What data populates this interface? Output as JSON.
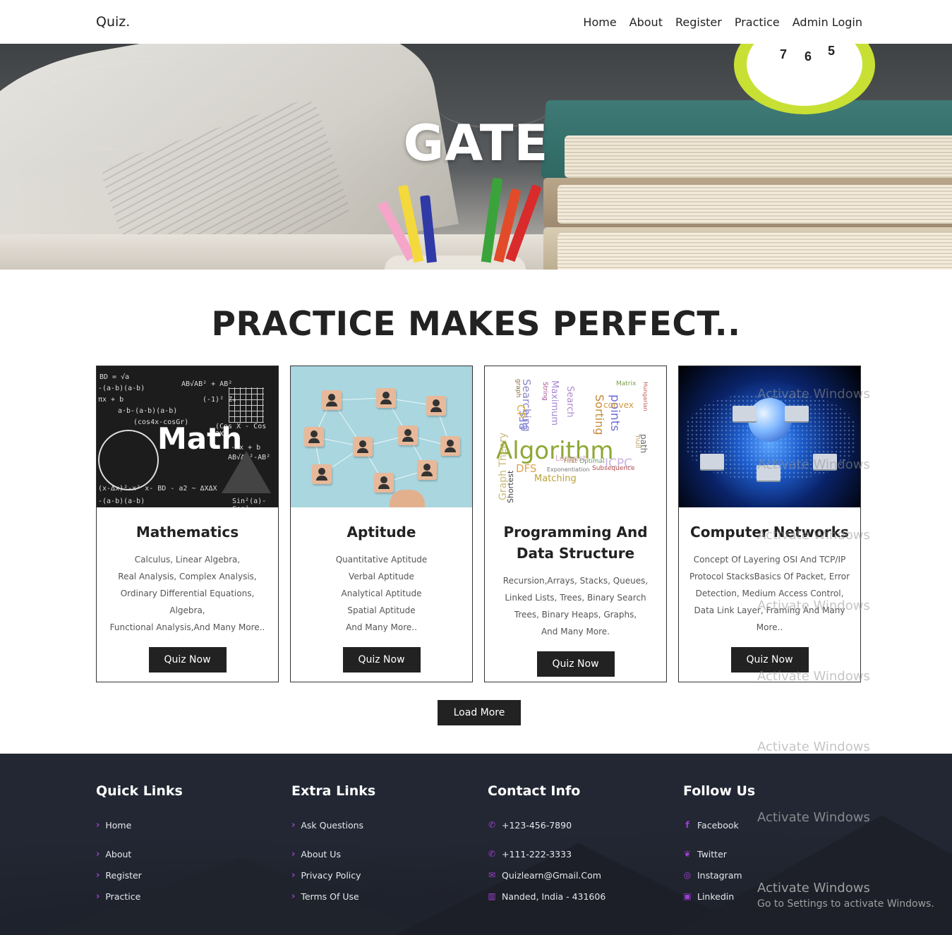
{
  "nav": {
    "brand": "Quiz.",
    "links": [
      "Home",
      "About",
      "Register",
      "Practice",
      "Admin Login"
    ]
  },
  "hero": {
    "title": "GATE"
  },
  "practice": {
    "title": "PRACTICE MAKES PERFECT..",
    "cards": [
      {
        "title": "Mathematics",
        "image": "math-chalkboard-image",
        "desc": [
          "Calculus, Linear Algebra,",
          "Real Analysis, Complex Analysis,",
          "Ordinary Differential Equations,",
          "Algebra,",
          "Functional Analysis,And Many More.."
        ],
        "button": "Quiz Now"
      },
      {
        "title": "Aptitude",
        "image": "network-blocks-image",
        "desc": [
          "Quantitative Aptitude",
          "Verbal Aptitude",
          "Analytical Aptitude",
          "Spatial Aptitude",
          "And Many More.."
        ],
        "button": "Quiz Now"
      },
      {
        "title": "Programming And Data Structure",
        "title_lines": [
          "Programming And",
          "Data Structure"
        ],
        "image": "algorithm-word-cloud-image",
        "desc": [
          "Recursion,Arrays, Stacks, Queues,",
          "Linked Lists, Trees, Binary Search",
          "Trees, Binary Heaps, Graphs,",
          "And Many More."
        ],
        "button": "Quiz Now"
      },
      {
        "title": "Computer Networks",
        "image": "globe-network-image",
        "desc": [
          "Concept Of Layering OSI And TCP/IP",
          "Protocol StacksBasics Of Packet, Error",
          "Detection, Medium Access Control,",
          "Data Link Layer, Framing And Many",
          "More.."
        ],
        "button": "Quiz Now"
      }
    ],
    "load_more": "Load More"
  },
  "images": {
    "math": {
      "word": "Math",
      "formulas": [
        "BD = √a",
        "-(a-b)(a-b)",
        "πx + b",
        "a·b-(a-b)(a-b)",
        "(cos4x-cosGr)",
        "AB√AB² + AB²",
        "(-1)² Z₀",
        "(Cos X - Cos 3X)",
        "AB√AB²-AB²",
        "-mx + b",
        "(x-Δx)²-x²  x- BD - a2 ~ ΔXΔX",
        "-(a-b)(a-b)",
        "Sin²(a)-Cos²"
      ]
    },
    "algo": {
      "words": [
        "Algorithm",
        "Searching",
        "Sorting",
        "Graph Theory",
        "BFS",
        "DFS",
        "points",
        "convex",
        "Matching",
        "Shortest",
        "path",
        "ICPC",
        "Maximum",
        "Longest",
        "Subsequence",
        "Hungarian",
        "Exponentiation",
        "First",
        "Optimal",
        "Search",
        "null",
        "graph",
        "CP",
        "Matrix",
        "String"
      ]
    }
  },
  "footer": {
    "quick_links": {
      "title": "Quick Links",
      "items": [
        "Home",
        "About",
        "Register",
        "Practice"
      ]
    },
    "extra_links": {
      "title": "Extra Links",
      "items": [
        "Ask Questions",
        "About Us",
        "Privacy Policy",
        "Terms Of Use"
      ]
    },
    "contact": {
      "title": "Contact Info",
      "items": [
        {
          "icon": "phone-icon",
          "text": "+123-456-7890"
        },
        {
          "icon": "phone-icon",
          "text": "+111-222-3333"
        },
        {
          "icon": "envelope-icon",
          "text": "Quizlearn@Gmail.Com"
        },
        {
          "icon": "map-icon",
          "text": "Nanded, India - 431606"
        }
      ]
    },
    "follow": {
      "title": "Follow Us",
      "items": [
        {
          "icon": "facebook-icon",
          "text": "Facebook"
        },
        {
          "icon": "twitter-icon",
          "text": "Twitter"
        },
        {
          "icon": "instagram-icon",
          "text": "Instagram"
        },
        {
          "icon": "linkedin-icon",
          "text": "Linkedin"
        }
      ]
    }
  },
  "watermark": {
    "title": "Activate Windows",
    "subtitle": "Go to Settings to activate Windows."
  },
  "colors": {
    "accent": "#a23fd6",
    "dark": "#222222",
    "footer_bg": "#222733"
  }
}
